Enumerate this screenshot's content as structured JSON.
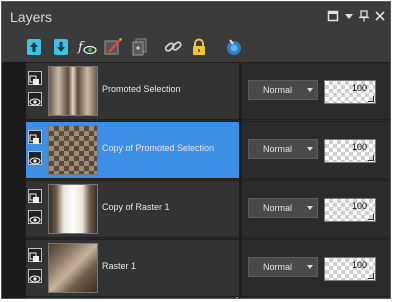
{
  "window": {
    "title": "Layers",
    "buttons": [
      {
        "icon": "restore-icon"
      },
      {
        "icon": "menu-caret-icon"
      },
      {
        "icon": "pin-icon"
      },
      {
        "icon": "close-icon"
      }
    ]
  },
  "toolbar": {
    "tools": [
      {
        "icon": "merge-up-icon"
      },
      {
        "icon": "merge-down-icon"
      },
      {
        "icon": "visibility-toggle-icon"
      },
      {
        "icon": "edit-mask-icon"
      },
      {
        "icon": "copy-layer-icon"
      },
      {
        "icon": "link-icon"
      },
      {
        "icon": "lock-icon"
      },
      {
        "icon": "palette-icon"
      }
    ]
  },
  "layers": [
    {
      "name": "Promoted Selection",
      "blend": "Normal",
      "opacity": "100",
      "selected": false
    },
    {
      "name": "Copy of Promoted Selection",
      "blend": "Normal",
      "opacity": "100",
      "selected": true
    },
    {
      "name": "Copy of Raster 1",
      "blend": "Normal",
      "opacity": "100",
      "selected": false
    },
    {
      "name": "Raster 1",
      "blend": "Normal",
      "opacity": "100",
      "selected": false
    }
  ],
  "colors": {
    "selected_row": "#3d8fe6",
    "panel_bg": "#2e2e2e",
    "accent_cyan": "#3ec3e8"
  }
}
